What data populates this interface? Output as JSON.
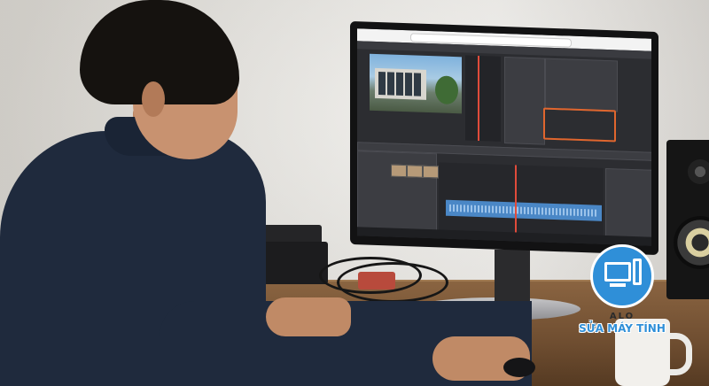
{
  "logo": {
    "line1": "ALO",
    "line2": "SỬA MÁY TÍNH",
    "color": "#2f8fd8"
  },
  "screen": {
    "app_highlight_color": "#e0662e",
    "timeline_clip_color": "#4a87c6",
    "playhead_color": "#e04b3b"
  }
}
